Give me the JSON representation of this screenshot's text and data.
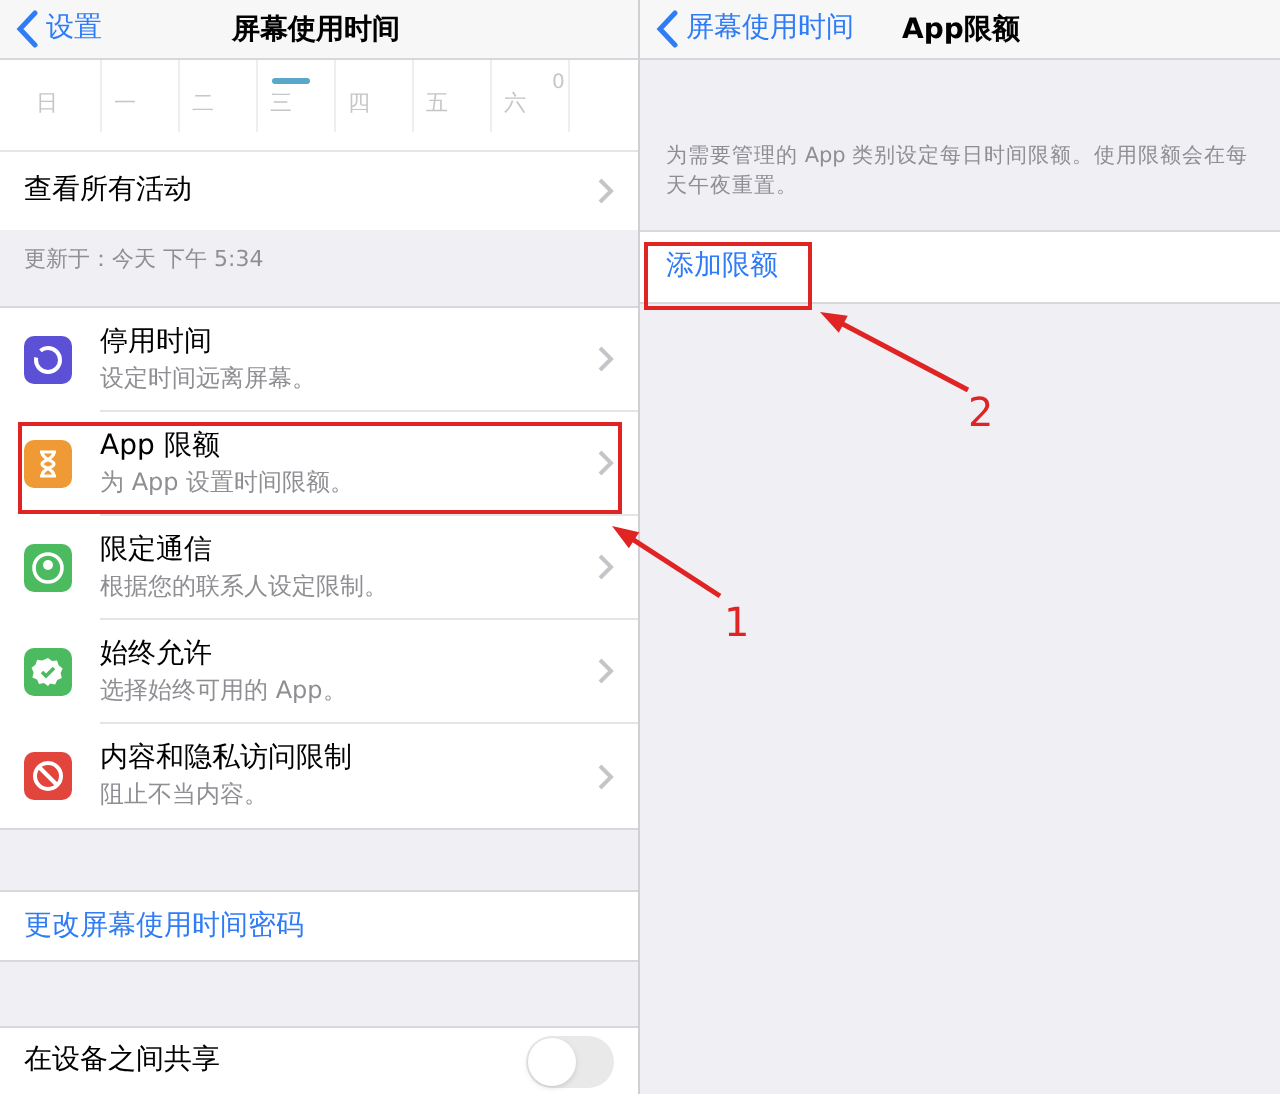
{
  "left_screen": {
    "nav": {
      "back": "设置",
      "title": "屏幕使用时间"
    },
    "chart": {
      "days": [
        "日",
        "一",
        "二",
        "三",
        "四",
        "五",
        "六"
      ],
      "axis_label": "0"
    },
    "see_all": "查看所有活动",
    "updated": "更新于：今天 下午 5:34",
    "items": [
      {
        "kind": "downtime",
        "title": "停用时间",
        "subtitle": "设定时间远离屏幕。",
        "color": "#5b50d6"
      },
      {
        "kind": "limits",
        "title": "App 限额",
        "subtitle": "为 App 设置时间限额。",
        "color": "#f09a36"
      },
      {
        "kind": "communication",
        "title": "限定通信",
        "subtitle": "根据您的联系人设定限制。",
        "color": "#4cbb5f"
      },
      {
        "kind": "allowed",
        "title": "始终允许",
        "subtitle": "选择始终可用的 App。",
        "color": "#4cbb5f"
      },
      {
        "kind": "restrictions",
        "title": "内容和隐私访问限制",
        "subtitle": "阻止不当内容。",
        "color": "#e2453c"
      }
    ],
    "change_passcode": "更改屏幕使用时间密码",
    "share": {
      "label": "在设备之间共享",
      "on": false
    }
  },
  "right_screen": {
    "nav": {
      "back": "屏幕使用时间",
      "title": "App限额"
    },
    "description": "为需要管理的 App 类别设定每日时间限额。使用限额会在每天午夜重置。",
    "add_limit": "添加限额"
  },
  "annotations": [
    {
      "label": "1"
    },
    {
      "label": "2"
    }
  ]
}
